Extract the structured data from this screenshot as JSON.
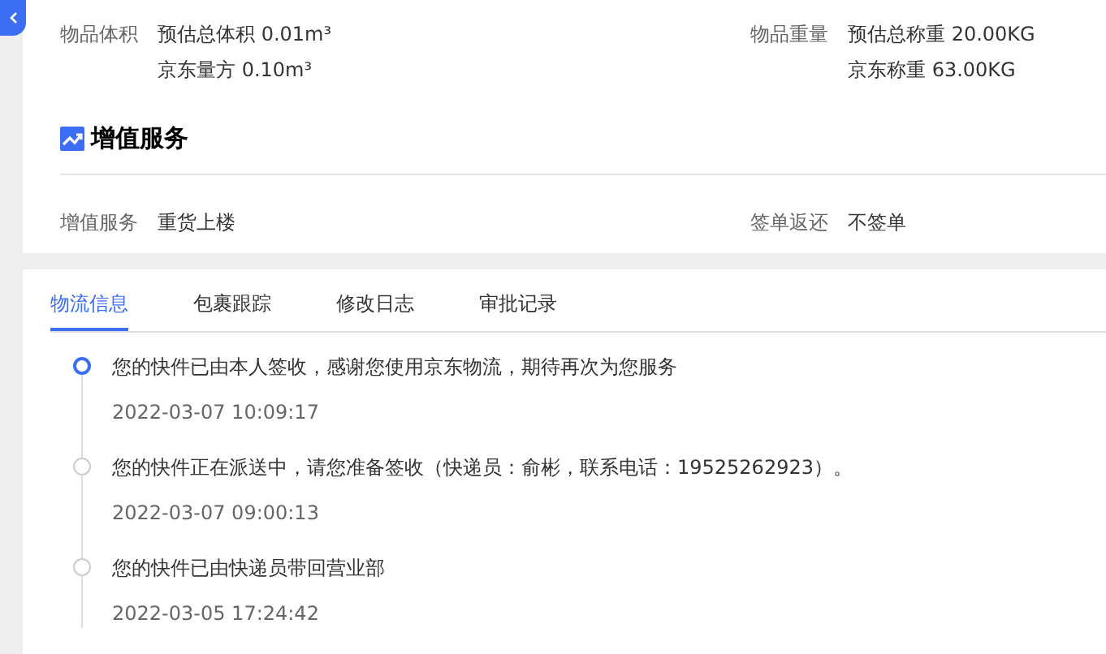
{
  "specs": [
    {
      "label": "物品体积",
      "values": [
        "预估总体积 0.01m³",
        "京东量方 0.10m³"
      ]
    },
    {
      "label": "物品重量",
      "values": [
        "预估总称重 20.00KG",
        "京东称重 63.00KG"
      ]
    }
  ],
  "section": {
    "title": "增值服务"
  },
  "services": [
    {
      "label": "增值服务",
      "value": "重货上楼"
    },
    {
      "label": "签单返还",
      "value": "不签单"
    }
  ],
  "tabs": [
    {
      "label": "物流信息",
      "selected": true
    },
    {
      "label": "包裹跟踪",
      "selected": false
    },
    {
      "label": "修改日志",
      "selected": false
    },
    {
      "label": "审批记录",
      "selected": false
    }
  ],
  "timeline": [
    {
      "text": "您的快件已由本人签收，感谢您使用京东物流，期待再次为您服务",
      "time": "2022-03-07 10:09:17",
      "current": true
    },
    {
      "text": "您的快件正在派送中，请您准备签收（快递员：俞彬，联系电话：19525262923）。",
      "time": "2022-03-07 09:00:13",
      "current": false
    },
    {
      "text": "您的快件已由快递员带回营业部",
      "time": "2022-03-05 17:24:42",
      "current": false
    }
  ]
}
